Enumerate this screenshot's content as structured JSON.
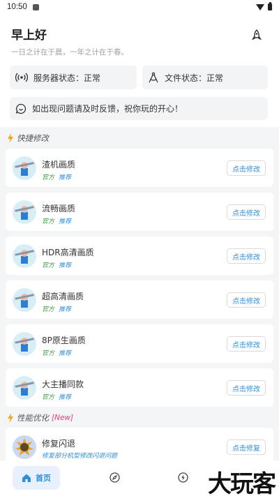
{
  "statusbar": {
    "time": "10:50"
  },
  "header": {
    "greeting": "早上好",
    "quote": "一日之计在于晨，一年之计在于春。"
  },
  "info": {
    "server_status": "服务器状态：正常",
    "file_status": "文件状态：正常",
    "feedback": "如出现问题请及时反馈，祝你玩的开心！"
  },
  "sections": {
    "quick": {
      "title": "快捷修改"
    },
    "perf": {
      "title": "性能优化",
      "badge": "[New]"
    }
  },
  "tags": {
    "official": "官方",
    "recommend": "推荐"
  },
  "items": [
    {
      "title": "渣机画质",
      "button": "点击修改"
    },
    {
      "title": "流畅画质",
      "button": "点击修改"
    },
    {
      "title": "HDR高清画质",
      "button": "点击修改"
    },
    {
      "title": "超高清画质",
      "button": "点击修改"
    },
    {
      "title": "8P原生画质",
      "button": "点击修改"
    },
    {
      "title": "大主播同款",
      "button": "点击修改"
    }
  ],
  "perf_items": [
    {
      "title": "修复闪退",
      "subtitle": "修复部分机型修改闪退问题",
      "button": "点击修复"
    }
  ],
  "tabbar": {
    "home_label": "首页"
  },
  "watermark": "大玩客",
  "colors": {
    "accent": "#2f8fd8",
    "official": "#43a047",
    "new_badge": "#e0407b",
    "bolt": "#f5a623"
  }
}
